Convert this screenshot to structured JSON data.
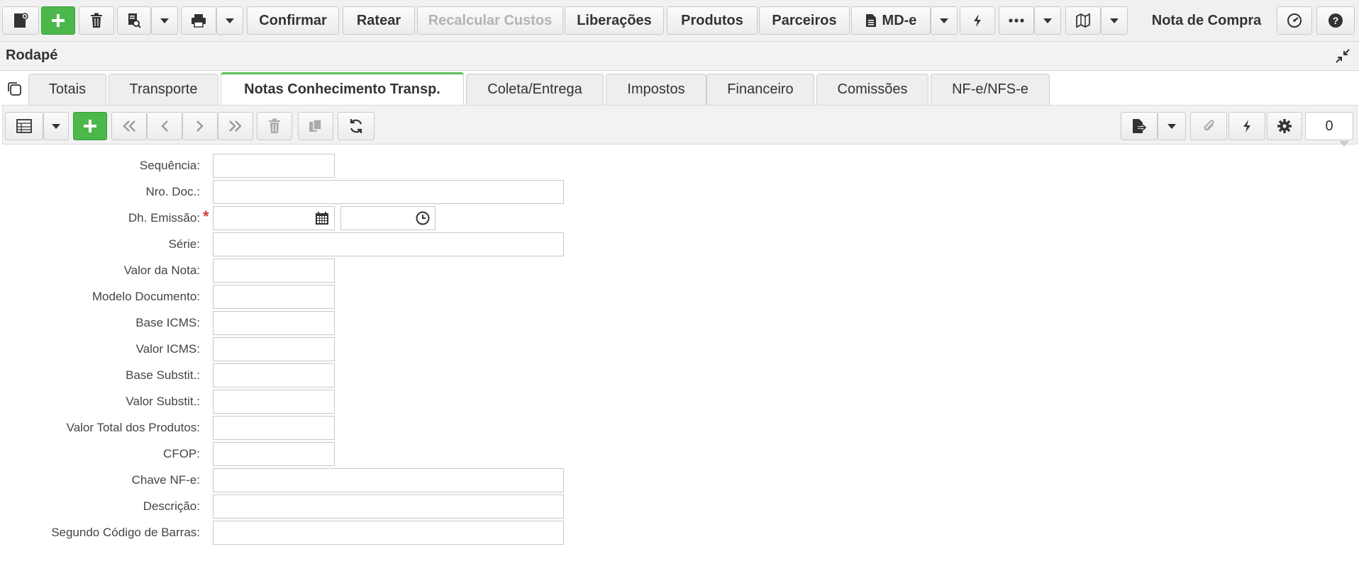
{
  "toolbar": {
    "confirm_label": "Confirmar",
    "rate_label": "Ratear",
    "recalc_label": "Recalcular Custos",
    "releases_label": "Liberações",
    "products_label": "Produtos",
    "partners_label": "Parceiros",
    "mde_label": "MD-e",
    "window_title": "Nota de Compra"
  },
  "section": {
    "title": "Rodapé"
  },
  "tabs": [
    {
      "label": "Totais",
      "active": false
    },
    {
      "label": "Transporte",
      "active": false
    },
    {
      "label": "Notas Conhecimento Transp.",
      "active": true
    },
    {
      "label": "Coleta/Entrega",
      "active": false
    },
    {
      "label": "Impostos",
      "active": false
    },
    {
      "label": "Financeiro",
      "active": false
    },
    {
      "label": "Comissões",
      "active": false
    },
    {
      "label": "NF-e/NFS-e",
      "active": false
    }
  ],
  "gridbar": {
    "record_count": "0"
  },
  "form": {
    "fields": [
      {
        "label": "Sequência:",
        "value": ""
      },
      {
        "label": "Nro. Doc.:",
        "value": ""
      },
      {
        "label": "Dh. Emissão:",
        "value": "",
        "required": true
      },
      {
        "label": "Série:",
        "value": ""
      },
      {
        "label": "Valor da Nota:",
        "value": ""
      },
      {
        "label": "Modelo Documento:",
        "value": ""
      },
      {
        "label": "Base ICMS:",
        "value": ""
      },
      {
        "label": "Valor ICMS:",
        "value": ""
      },
      {
        "label": "Base Substit.:",
        "value": ""
      },
      {
        "label": "Valor Substit.:",
        "value": ""
      },
      {
        "label": "Valor Total dos Produtos:",
        "value": ""
      },
      {
        "label": "CFOP:",
        "value": ""
      },
      {
        "label": "Chave NF-e:",
        "value": ""
      },
      {
        "label": "Descrição:",
        "value": ""
      },
      {
        "label": "Segundo Código de Barras:",
        "value": ""
      }
    ]
  },
  "colors": {
    "accent_green": "#4cb84c",
    "active_tab_border": "#5cbf5c",
    "required_mark": "#d43b3b",
    "disabled_text": "#b3b3b3"
  },
  "icons": [
    "new-document-icon",
    "plus-icon",
    "trash-icon",
    "search-document-icon",
    "chevron-down-icon",
    "print-icon",
    "file-icon",
    "bolt-icon",
    "more-icon",
    "map-icon",
    "dashboard-icon",
    "help-icon",
    "collapse-icon",
    "copy-icon",
    "grid-icon",
    "first-icon",
    "prev-icon",
    "next-icon",
    "last-icon",
    "duplicate-icon",
    "refresh-icon",
    "export-icon",
    "attach-icon",
    "gear-icon",
    "calendar-icon",
    "clock-icon"
  ]
}
